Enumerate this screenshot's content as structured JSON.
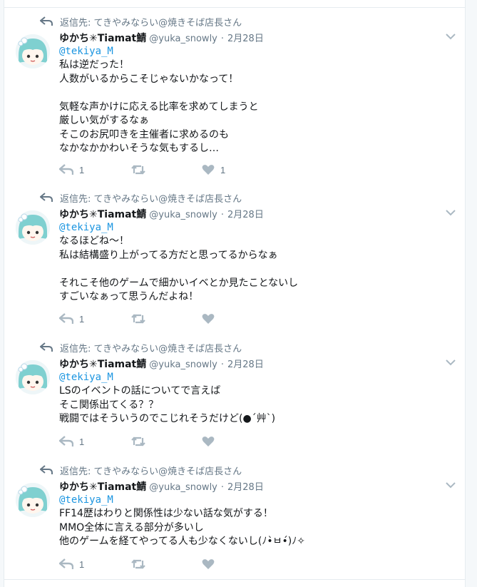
{
  "colors": {
    "accent": "#1b95e0",
    "muted": "#657786",
    "icon": "#aab8c2",
    "border": "#e6ecf0"
  },
  "tweets": [
    {
      "reply_context": "返信先: てきやみならい@焼きそば店長さん",
      "name": "ゆかち✳Tiamat鯖",
      "handle": "@yuka_snowly",
      "dot": "·",
      "date": "2月28日",
      "mention": "@tekiya_M",
      "text": "私は逆だった！\n人数がいるからこそじゃないかなって！\n\n気軽な声かけに応える比率を求めてしまうと\n厳しい気がするなぁ\nそこのお尻叩きを主催者に求めるのも\nなかなかかわいそうな気もするし…",
      "reply_count": "1",
      "like_count": "1"
    },
    {
      "reply_context": "返信先: てきやみならい@焼きそば店長さん",
      "name": "ゆかち✳Tiamat鯖",
      "handle": "@yuka_snowly",
      "dot": "·",
      "date": "2月28日",
      "mention": "@tekiya_M",
      "text": "なるほどね〜！\n私は結構盛り上がってる方だと思ってるからなぁ\n\nそれこそ他のゲームで細かいイベとか見たことないし\nすごいなぁって思うんだよね！",
      "reply_count": "1",
      "like_count": ""
    },
    {
      "reply_context": "返信先: てきやみならい@焼きそば店長さん",
      "name": "ゆかち✳Tiamat鯖",
      "handle": "@yuka_snowly",
      "dot": "·",
      "date": "2月28日",
      "mention": "@tekiya_M",
      "text": "LSのイベントの話についてで言えば\nそこ関係出てくる？？\n戦闘ではそういうのでこじれそうだけど(●´艸`)",
      "reply_count": "1",
      "like_count": ""
    },
    {
      "reply_context": "返信先: てきやみならい@焼きそば店長さん",
      "name": "ゆかち✳Tiamat鯖",
      "handle": "@yuka_snowly",
      "dot": "·",
      "date": "2月28日",
      "mention": "@tekiya_M",
      "text": "FF14歴はわりと関係性は少ない話な気がする！\nMMO全体に言える部分が多いし\n他のゲームを経てやってる人も少なくないし(ﾉ•̀ㅂ•́)ﾉ✧",
      "reply_count": "1",
      "like_count": ""
    }
  ]
}
